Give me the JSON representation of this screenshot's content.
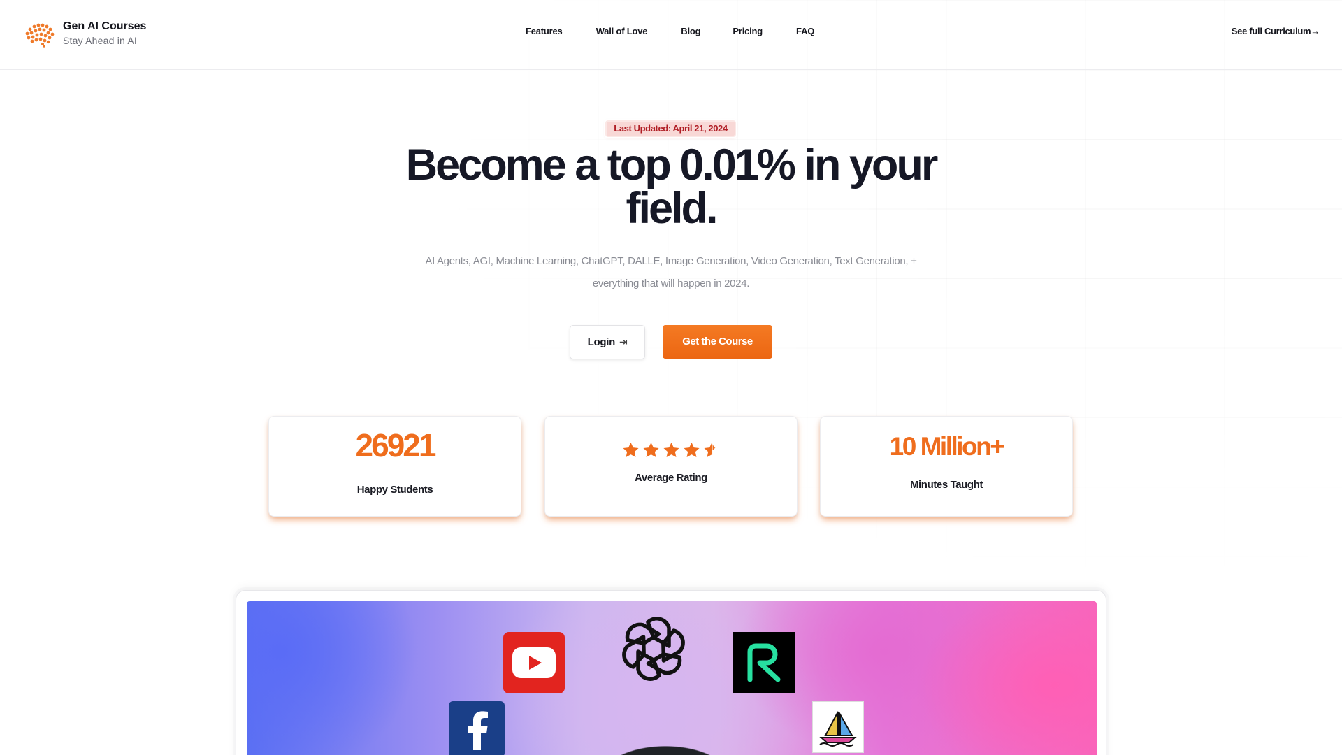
{
  "brand": {
    "name": "Gen AI Courses",
    "tagline": "Stay Ahead in AI",
    "logo_icon": "brain-icon",
    "accent_color": "#ef6d1d"
  },
  "nav": {
    "items": [
      {
        "label": "Features"
      },
      {
        "label": "Wall of Love"
      },
      {
        "label": "Blog"
      },
      {
        "label": "Pricing"
      },
      {
        "label": "FAQ"
      }
    ],
    "cta_label": "See full Curriculum"
  },
  "hero": {
    "badge": "Last Updated: April 21, 2024",
    "headline_line1": "Become a top 0.01% in your",
    "headline_line2": "field.",
    "subtext_line1": "AI Agents, AGI, Machine Learning, ChatGPT, DALLE, Image Generation, Video Generation, Text Generation, +",
    "subtext_line2": "everything that will happen in 2024.",
    "login_label": "Login",
    "cta_label": "Get the Course"
  },
  "stats": [
    {
      "value": "26921",
      "label": "Happy Students"
    },
    {
      "value": 4.5,
      "max": 5,
      "label": "Average Rating"
    },
    {
      "value": "10 Million+",
      "label": "Minutes Taught"
    }
  ],
  "media": {
    "logos": [
      "youtube-icon",
      "openai-icon",
      "runway-icon",
      "facebook-icon",
      "midjourney-icon"
    ]
  }
}
